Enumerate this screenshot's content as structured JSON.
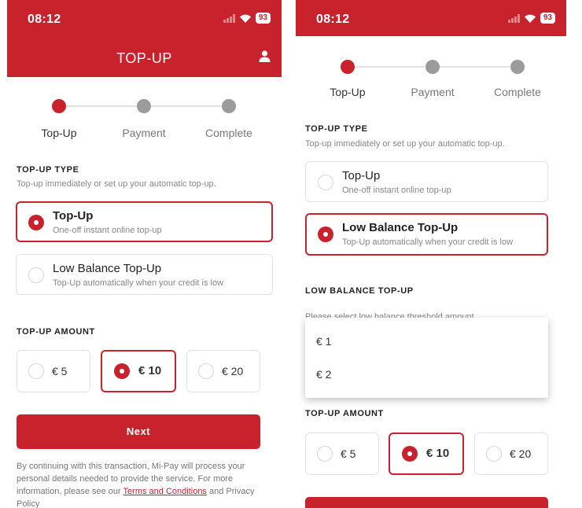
{
  "left": {
    "status": {
      "time": "08:12",
      "battery": "93"
    },
    "header": {
      "title": "TOP-UP"
    },
    "steps": [
      "Top-Up",
      "Payment",
      "Complete"
    ],
    "topup_type": {
      "title": "TOP-UP TYPE",
      "subtitle": "Top-up immediately or set up your automatic top-up.",
      "options": [
        {
          "title": "Top-Up",
          "desc": "One-off instant online top-up",
          "selected": true
        },
        {
          "title": "Low Balance Top-Up",
          "desc": "Top-Up automatically when your credit is low",
          "selected": false
        }
      ]
    },
    "amount": {
      "title": "TOP-UP AMOUNT",
      "options": [
        {
          "label": "€ 5",
          "selected": false
        },
        {
          "label": "€ 10",
          "selected": true
        },
        {
          "label": "€ 20",
          "selected": false
        }
      ]
    },
    "next_label": "Next",
    "disclaimer": {
      "text1": "By continuing with this transaction, Mi-Pay will process your personal details needed to provide the service. For more information, please see our",
      "link": "Terms and Conditions",
      "text2": "and",
      "text3": "Privacy Policy"
    }
  },
  "right": {
    "status": {
      "time": "08:12",
      "battery": "93"
    },
    "steps": [
      "Top-Up",
      "Payment",
      "Complete"
    ],
    "topup_type": {
      "title": "TOP-UP TYPE",
      "subtitle": "Top-up immediately or set up your automatic top-up.",
      "options": [
        {
          "title": "Top-Up",
          "desc": "One-off instant online top-up",
          "selected": false
        },
        {
          "title": "Low Balance Top-Up",
          "desc": "Top-Up automatically when your credit is low",
          "selected": true
        }
      ]
    },
    "low_balance": {
      "title": "LOW BALANCE TOP-UP",
      "hint": "Please select low balance threshold amount",
      "dropdown_options": [
        "€ 1",
        "€ 2"
      ]
    },
    "amount": {
      "title": "TOP-UP AMOUNT",
      "options": [
        {
          "label": "€ 5",
          "selected": false
        },
        {
          "label": "€ 10",
          "selected": true
        },
        {
          "label": "€ 20",
          "selected": false
        }
      ]
    }
  },
  "colors": {
    "brand": "#c8232c",
    "inactive_step": "#9b9b9b",
    "border": "#e3e3e3"
  },
  "icons": [
    "user-icon",
    "signal-icon",
    "wifi-icon",
    "battery-icon"
  ]
}
